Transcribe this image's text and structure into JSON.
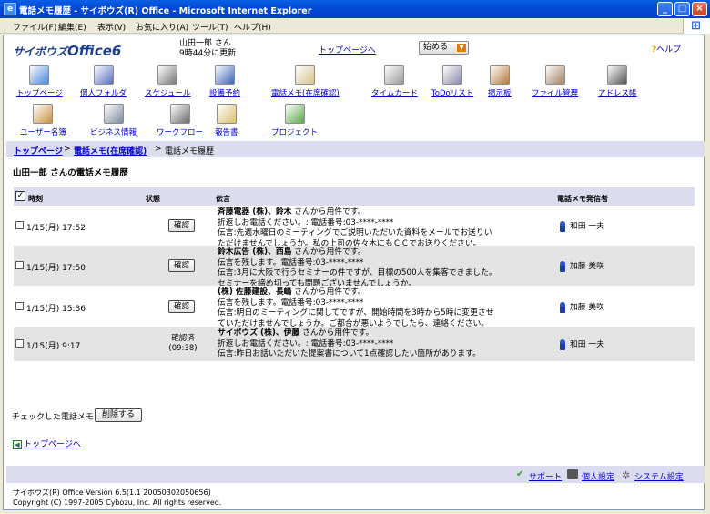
{
  "window": {
    "title": "電話メモ履歴 - サイボウズ(R) Office - Microsoft Internet Explorer"
  },
  "menu": [
    "ファイル(F)",
    "編集(E)",
    "表示(V)",
    "お気に入り(A)",
    "ツール(T)",
    "ヘルプ(H)"
  ],
  "header": {
    "logo_prefix": "サイボウズ",
    "logo_main": "Office6",
    "user_line1": "山田一郎 さん",
    "user_line2": "9時44分に更新",
    "top_link": "トップページへ",
    "start_label": "始める",
    "help_label": "ヘルプ"
  },
  "nav": [
    {
      "label": "トップページ",
      "icon": "top-page-icon",
      "color": "#4A86D8"
    },
    {
      "label": "個人フォルダ",
      "icon": "personal-folder-icon",
      "color": "#5B6FC4"
    },
    {
      "label": "スケジュール",
      "icon": "schedule-icon",
      "color": "#777777"
    },
    {
      "label": "設備予約",
      "icon": "facility-reservation-icon",
      "color": "#3C63B8"
    },
    {
      "label": "電話メモ(在席確認)",
      "icon": "phone-memo-icon",
      "color": "#D4C48C"
    },
    {
      "label": "タイムカード",
      "icon": "timecard-icon",
      "color": "#9A9A9A"
    },
    {
      "label": "ToDoリスト",
      "icon": "todo-list-icon",
      "color": "#8A8AAA"
    },
    {
      "label": "掲示板",
      "icon": "bulletin-board-icon",
      "color": "#B87A3A"
    },
    {
      "label": "ファイル管理",
      "icon": "file-management-icon",
      "color": "#A08060"
    },
    {
      "label": "アドレス帳",
      "icon": "address-book-icon",
      "color": "#555555"
    },
    {
      "label": "ユーザー名簿",
      "icon": "user-directory-icon",
      "color": "#C89040"
    },
    {
      "label": "ビジネス情報",
      "icon": "business-info-icon",
      "color": "#7A8AA0"
    },
    {
      "label": "ワークフロー",
      "icon": "workflow-icon",
      "color": "#6A6A6A"
    },
    {
      "label": "報告書",
      "icon": "report-icon",
      "color": "#D8C070"
    },
    {
      "label": "プロジェクト",
      "icon": "project-icon",
      "color": "#5AA84A"
    }
  ],
  "breadcrumb": {
    "top": "トップページ",
    "memo": "電話メモ(在席確認)",
    "current": "電話メモ履歴",
    "sep": ">"
  },
  "page_title": "山田一郎 さんの電話メモ履歴",
  "table": {
    "col_time": "時刻",
    "col_status": "状態",
    "col_message": "伝言",
    "col_sender": "電話メモ発信者",
    "rows": [
      {
        "time": "1/15(月) 17:52",
        "status_button": "確認",
        "status_text": "",
        "msg_company": "斉藤電器 (株)、鈴木",
        "msg_suffix": " さんから用件です。",
        "lines": [
          "折返しお電話ください。: 電話番号:03-****-****",
          "伝言:先週水曜日のミーティングでご説明いただいた資料をメールでお送りい",
          "ただけませんでしょうか。私の上司の佐々木にもＣＣでお送りください。"
        ],
        "sender": "和田 一夫"
      },
      {
        "time": "1/15(月) 17:50",
        "status_button": "確認",
        "status_text": "",
        "msg_company": "鈴木広告 (株)、西島",
        "msg_suffix": " さんから用件です。",
        "lines": [
          "伝言を残します。電話番号:03-****-****",
          "伝言:3月に大阪で行うセミナーの件ですが、目標の500人を集客できました。",
          "セミナーを締め切っても問題ございませんでしょうか。"
        ],
        "sender": "加藤 美咲"
      },
      {
        "time": "1/15(月) 15:36",
        "status_button": "確認",
        "status_text": "",
        "msg_company": "(株) 佐藤建設、長嶋",
        "msg_suffix": " さんから用件です。",
        "lines": [
          "伝言を残します。電話番号:03-****-****",
          "伝言:明日のミーティングに関してですが、開始時間を3時から5時に変更させ",
          "ていただけませんでしょうか。ご都合が悪いようでしたら、連絡ください。"
        ],
        "sender": "加藤 美咲"
      },
      {
        "time": "1/15(月) 9:17",
        "status_button": "",
        "status_text": "確認済",
        "status_sub": "(09:38)",
        "msg_company": "サイボウズ (株)、伊藤",
        "msg_suffix": " さんから用件です。",
        "lines": [
          "折返しお電話ください。: 電話番号:03-****-****",
          "伝言:昨日お話いただいた提案書について1点確認したい箇所があります。"
        ],
        "sender": "和田 一夫"
      }
    ]
  },
  "delete": {
    "label": "チェックした電話メモを",
    "button": "削除する"
  },
  "back_top": "トップページへ",
  "footer": {
    "support": "サポート",
    "personal": "個人設定",
    "system": "システム設定"
  },
  "version": {
    "line1": "サイボウズ(R) Office Version 6.5(1.1 20050302050656)",
    "line2": "Copyright (C) 1997-2005 Cybozu, Inc. All rights reserved."
  }
}
